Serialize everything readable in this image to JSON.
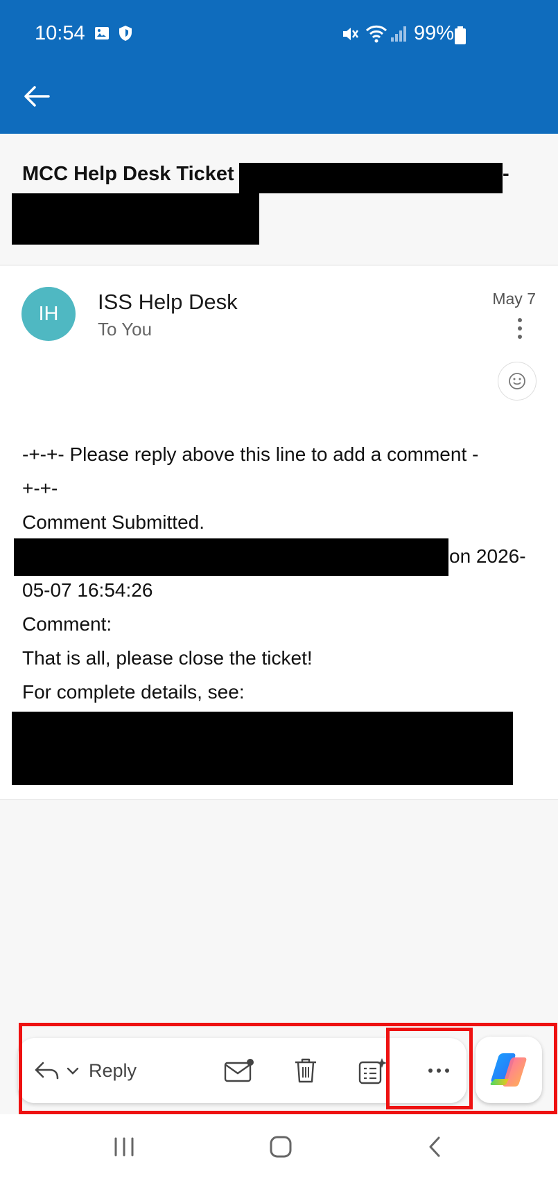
{
  "status_bar": {
    "time": "10:54",
    "battery": "99%",
    "icons": [
      "gallery-icon",
      "shield-icon",
      "mute-icon",
      "wifi-icon",
      "signal-icon",
      "battery-icon"
    ]
  },
  "app_bar": {
    "back_icon": "arrow-left-icon",
    "color": "#0f6cbd"
  },
  "subject": {
    "prefix": "MCC Help Desk Ticket",
    "suffix": "-"
  },
  "message": {
    "avatar_initials": "IH",
    "avatar_color": "#4fb8c2",
    "sender": "ISS Help Desk",
    "recipient": "To You",
    "date": "May 7",
    "body": {
      "line1": "-+-+- Please reply above this line to add a comment -",
      "line2": "+-+-",
      "line3": "Comment Submitted.",
      "line4_tail": "on 2026-",
      "line5": "05-07 16:54:26",
      "line6": "Comment:",
      "line7": "That is all, please close the ticket!",
      "line8": "For complete details, see:"
    }
  },
  "action_bar": {
    "reply_label": "Reply",
    "actions": [
      "mark-unread-icon",
      "delete-icon",
      "summarize-icon",
      "more-icon"
    ],
    "copilot_icon": "copilot-icon"
  },
  "highlight_color": "#ee1111",
  "nav_bar": {
    "buttons": [
      "recents-icon",
      "home-icon",
      "back-icon"
    ]
  }
}
